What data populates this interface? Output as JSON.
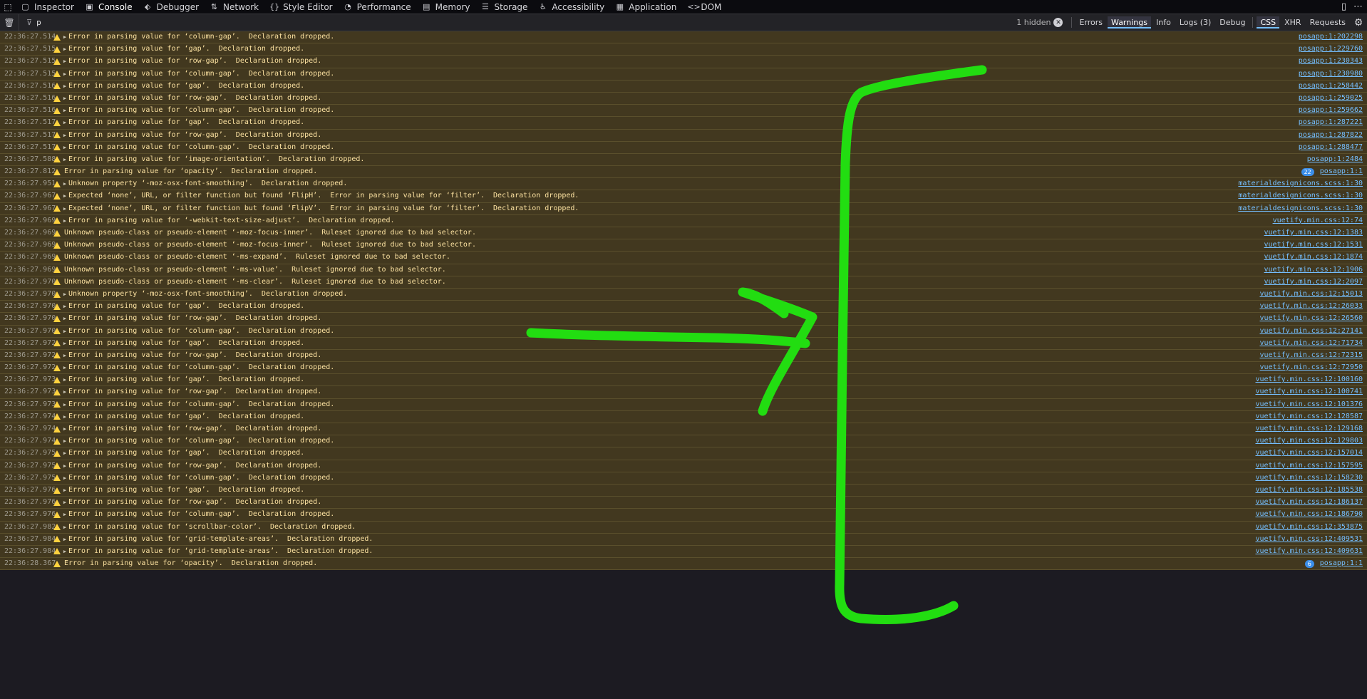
{
  "toolbar": {
    "tabs": [
      {
        "label": "Inspector",
        "icon": "inspector-icon",
        "glyph": "▢"
      },
      {
        "label": "Console",
        "icon": "console-icon",
        "glyph": "▣",
        "active": true
      },
      {
        "label": "Debugger",
        "icon": "debugger-icon",
        "glyph": "⬖"
      },
      {
        "label": "Network",
        "icon": "network-icon",
        "glyph": "⇅"
      },
      {
        "label": "Style Editor",
        "icon": "style-editor-icon",
        "glyph": "{}"
      },
      {
        "label": "Performance",
        "icon": "performance-icon",
        "glyph": "◔"
      },
      {
        "label": "Memory",
        "icon": "memory-icon",
        "glyph": "▤"
      },
      {
        "label": "Storage",
        "icon": "storage-icon",
        "glyph": "☰"
      },
      {
        "label": "Accessibility",
        "icon": "accessibility-icon",
        "glyph": "♿"
      },
      {
        "label": "Application",
        "icon": "application-icon",
        "glyph": "▦"
      },
      {
        "label": "DOM",
        "icon": "dom-icon",
        "glyph": "<>"
      }
    ]
  },
  "filterbar": {
    "filter_value": "p",
    "hidden_count": "1 hidden",
    "buttons": [
      "Errors",
      "Warnings",
      "Info",
      "Logs (3)",
      "Debug"
    ],
    "active_button": "Warnings",
    "net_buttons": [
      "CSS",
      "XHR",
      "Requests"
    ],
    "active_net": "CSS"
  },
  "log": [
    {
      "time": "22:36:27.514",
      "arrow": true,
      "msg": "Error in parsing value for ‘column-gap’.  Declaration dropped.",
      "src": "posapp:1:202298"
    },
    {
      "time": "22:36:27.515",
      "arrow": true,
      "msg": "Error in parsing value for ‘gap’.  Declaration dropped.",
      "src": "posapp:1:229760"
    },
    {
      "time": "22:36:27.515",
      "arrow": true,
      "msg": "Error in parsing value for ‘row-gap’.  Declaration dropped.",
      "src": "posapp:1:230343"
    },
    {
      "time": "22:36:27.515",
      "arrow": true,
      "msg": "Error in parsing value for ‘column-gap’.  Declaration dropped.",
      "src": "posapp:1:230980"
    },
    {
      "time": "22:36:27.516",
      "arrow": true,
      "msg": "Error in parsing value for ‘gap’.  Declaration dropped.",
      "src": "posapp:1:258442"
    },
    {
      "time": "22:36:27.516",
      "arrow": true,
      "msg": "Error in parsing value for ‘row-gap’.  Declaration dropped.",
      "src": "posapp:1:259025"
    },
    {
      "time": "22:36:27.516",
      "arrow": true,
      "msg": "Error in parsing value for ‘column-gap’.  Declaration dropped.",
      "src": "posapp:1:259662"
    },
    {
      "time": "22:36:27.517",
      "arrow": true,
      "msg": "Error in parsing value for ‘gap’.  Declaration dropped.",
      "src": "posapp:1:287221"
    },
    {
      "time": "22:36:27.517",
      "arrow": true,
      "msg": "Error in parsing value for ‘row-gap’.  Declaration dropped.",
      "src": "posapp:1:287822"
    },
    {
      "time": "22:36:27.517",
      "arrow": true,
      "msg": "Error in parsing value for ‘column-gap’.  Declaration dropped.",
      "src": "posapp:1:288477"
    },
    {
      "time": "22:36:27.588",
      "arrow": true,
      "msg": "Error in parsing value for ‘image-orientation’.  Declaration dropped.",
      "src": "posapp:1:2484"
    },
    {
      "time": "22:36:27.812",
      "arrow": false,
      "msg": "Error in parsing value for ‘opacity’.  Declaration dropped.",
      "src": "posapp:1:1",
      "badge": "22"
    },
    {
      "time": "22:36:27.951",
      "arrow": true,
      "msg": "Unknown property ‘-moz-osx-font-smoothing’.  Declaration dropped.",
      "src": "materialdesignicons.scss:1:30"
    },
    {
      "time": "22:36:27.967",
      "arrow": true,
      "msg": "Expected ‘none’, URL, or filter function but found ‘FlipH’.  Error in parsing value for ‘filter’.  Declaration dropped.",
      "src": "materialdesignicons.scss:1:30"
    },
    {
      "time": "22:36:27.967",
      "arrow": true,
      "msg": "Expected ‘none’, URL, or filter function but found ‘FlipV’.  Error in parsing value for ‘filter’.  Declaration dropped.",
      "src": "materialdesignicons.scss:1:30"
    },
    {
      "time": "22:36:27.969",
      "arrow": true,
      "msg": "Error in parsing value for ‘-webkit-text-size-adjust’.  Declaration dropped.",
      "src": "vuetify.min.css:12:74"
    },
    {
      "time": "22:36:27.969",
      "arrow": false,
      "msg": "Unknown pseudo-class or pseudo-element ‘-moz-focus-inner’.  Ruleset ignored due to bad selector.",
      "src": "vuetify.min.css:12:1383"
    },
    {
      "time": "22:36:27.969",
      "arrow": false,
      "msg": "Unknown pseudo-class or pseudo-element ‘-moz-focus-inner’.  Ruleset ignored due to bad selector.",
      "src": "vuetify.min.css:12:1531"
    },
    {
      "time": "22:36:27.969",
      "arrow": false,
      "msg": "Unknown pseudo-class or pseudo-element ‘-ms-expand’.  Ruleset ignored due to bad selector.",
      "src": "vuetify.min.css:12:1874"
    },
    {
      "time": "22:36:27.969",
      "arrow": false,
      "msg": "Unknown pseudo-class or pseudo-element ‘-ms-value’.  Ruleset ignored due to bad selector.",
      "src": "vuetify.min.css:12:1906"
    },
    {
      "time": "22:36:27.970",
      "arrow": false,
      "msg": "Unknown pseudo-class or pseudo-element ‘-ms-clear’.  Ruleset ignored due to bad selector.",
      "src": "vuetify.min.css:12:2097"
    },
    {
      "time": "22:36:27.970",
      "arrow": true,
      "msg": "Unknown property ‘-moz-osx-font-smoothing’.  Declaration dropped.",
      "src": "vuetify.min.css:12:15013"
    },
    {
      "time": "22:36:27.970",
      "arrow": true,
      "msg": "Error in parsing value for ‘gap’.  Declaration dropped.",
      "src": "vuetify.min.css:12:26033"
    },
    {
      "time": "22:36:27.970",
      "arrow": true,
      "msg": "Error in parsing value for ‘row-gap’.  Declaration dropped.",
      "src": "vuetify.min.css:12:26560"
    },
    {
      "time": "22:36:27.970",
      "arrow": true,
      "msg": "Error in parsing value for ‘column-gap’.  Declaration dropped.",
      "src": "vuetify.min.css:12:27141"
    },
    {
      "time": "22:36:27.972",
      "arrow": true,
      "msg": "Error in parsing value for ‘gap’.  Declaration dropped.",
      "src": "vuetify.min.css:12:71734"
    },
    {
      "time": "22:36:27.972",
      "arrow": true,
      "msg": "Error in parsing value for ‘row-gap’.  Declaration dropped.",
      "src": "vuetify.min.css:12:72315"
    },
    {
      "time": "22:36:27.972",
      "arrow": true,
      "msg": "Error in parsing value for ‘column-gap’.  Declaration dropped.",
      "src": "vuetify.min.css:12:72950"
    },
    {
      "time": "22:36:27.973",
      "arrow": true,
      "msg": "Error in parsing value for ‘gap’.  Declaration dropped.",
      "src": "vuetify.min.css:12:100160"
    },
    {
      "time": "22:36:27.973",
      "arrow": true,
      "msg": "Error in parsing value for ‘row-gap’.  Declaration dropped.",
      "src": "vuetify.min.css:12:100741"
    },
    {
      "time": "22:36:27.973",
      "arrow": true,
      "msg": "Error in parsing value for ‘column-gap’.  Declaration dropped.",
      "src": "vuetify.min.css:12:101376"
    },
    {
      "time": "22:36:27.974",
      "arrow": true,
      "msg": "Error in parsing value for ‘gap’.  Declaration dropped.",
      "src": "vuetify.min.css:12:128587"
    },
    {
      "time": "22:36:27.974",
      "arrow": true,
      "msg": "Error in parsing value for ‘row-gap’.  Declaration dropped.",
      "src": "vuetify.min.css:12:129168"
    },
    {
      "time": "22:36:27.974",
      "arrow": true,
      "msg": "Error in parsing value for ‘column-gap’.  Declaration dropped.",
      "src": "vuetify.min.css:12:129803"
    },
    {
      "time": "22:36:27.975",
      "arrow": true,
      "msg": "Error in parsing value for ‘gap’.  Declaration dropped.",
      "src": "vuetify.min.css:12:157014"
    },
    {
      "time": "22:36:27.975",
      "arrow": true,
      "msg": "Error in parsing value for ‘row-gap’.  Declaration dropped.",
      "src": "vuetify.min.css:12:157595"
    },
    {
      "time": "22:36:27.975",
      "arrow": true,
      "msg": "Error in parsing value for ‘column-gap’.  Declaration dropped.",
      "src": "vuetify.min.css:12:158230"
    },
    {
      "time": "22:36:27.976",
      "arrow": true,
      "msg": "Error in parsing value for ‘gap’.  Declaration dropped.",
      "src": "vuetify.min.css:12:185538"
    },
    {
      "time": "22:36:27.976",
      "arrow": true,
      "msg": "Error in parsing value for ‘row-gap’.  Declaration dropped.",
      "src": "vuetify.min.css:12:186137"
    },
    {
      "time": "22:36:27.976",
      "arrow": true,
      "msg": "Error in parsing value for ‘column-gap’.  Declaration dropped.",
      "src": "vuetify.min.css:12:186790"
    },
    {
      "time": "22:36:27.982",
      "arrow": true,
      "msg": "Error in parsing value for ‘scrollbar-color’.  Declaration dropped.",
      "src": "vuetify.min.css:12:353875"
    },
    {
      "time": "22:36:27.984",
      "arrow": true,
      "msg": "Error in parsing value for ‘grid-template-areas’.  Declaration dropped.",
      "src": "vuetify.min.css:12:409531"
    },
    {
      "time": "22:36:27.984",
      "arrow": true,
      "msg": "Error in parsing value for ‘grid-template-areas’.  Declaration dropped.",
      "src": "vuetify.min.css:12:409631"
    },
    {
      "time": "22:36:28.367",
      "arrow": false,
      "msg": "Error in parsing value for ‘opacity’.  Declaration dropped.",
      "src": "posapp:1:1",
      "badge": "6"
    }
  ],
  "colors": {
    "warning_bg": "#42381f",
    "annotation": "#22dd11",
    "link": "#75bfff"
  }
}
